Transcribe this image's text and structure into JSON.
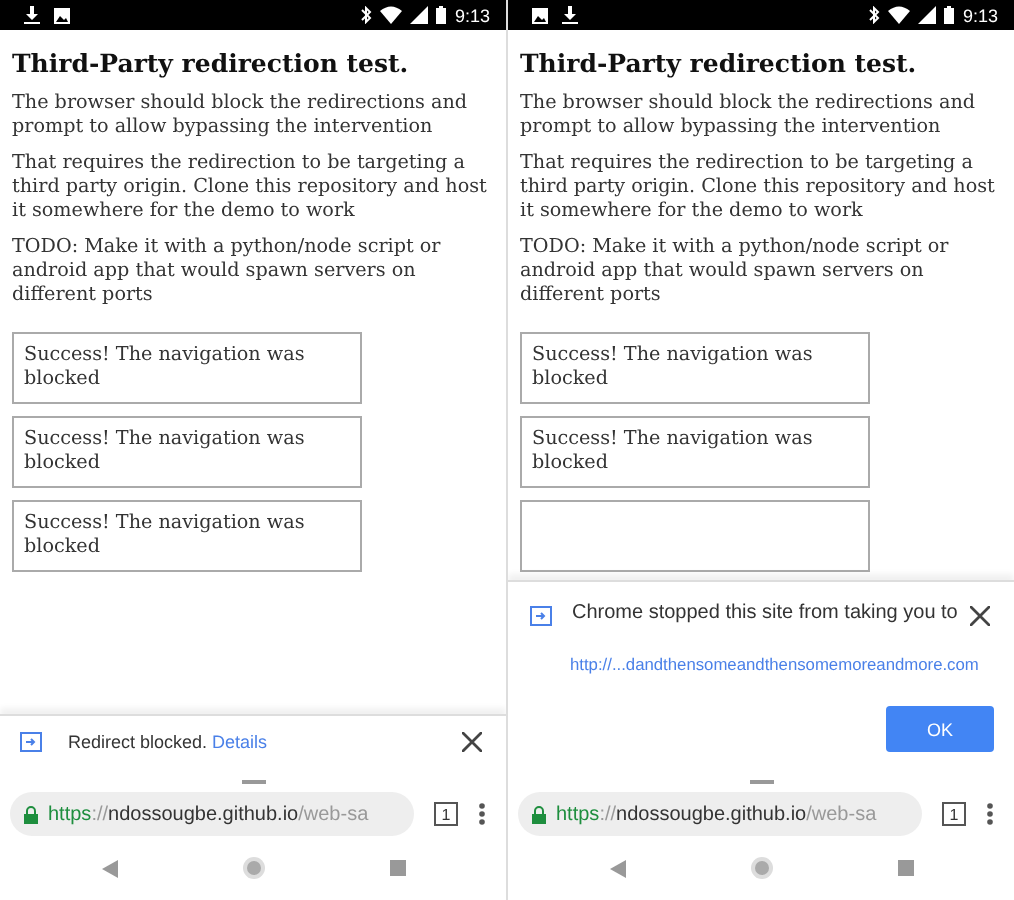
{
  "screens": [
    {
      "status": {
        "time": "9:13"
      },
      "page": {
        "title": "Third-Party redirection test.",
        "paragraphs": [
          "The browser should block the redirections and prompt to allow bypassing the intervention",
          "That requires the redirection to be targeting a third party origin. Clone this repository and host it somewhere for the demo to work",
          "TODO: Make it with a python/node script or android app that would spawn servers on different ports"
        ],
        "results": [
          "Success! The navigation was blocked",
          "Success! The navigation was blocked",
          "Success! The navigation was blocked"
        ]
      },
      "notice": {
        "kind": "infobar",
        "message": "Redirect blocked.",
        "link": "Details"
      },
      "omnibox": {
        "scheme": "https",
        "separator": "://",
        "host": "ndossougbe.github.io",
        "path": "/web-sa",
        "tab_count": "1"
      }
    },
    {
      "status": {
        "time": "9:13"
      },
      "page": {
        "title": "Third-Party redirection test.",
        "paragraphs": [
          "The browser should block the redirections and prompt to allow bypassing the intervention",
          "That requires the redirection to be targeting a third party origin. Clone this repository and host it somewhere for the demo to work",
          "TODO: Make it with a python/node script or android app that would spawn servers on different ports"
        ],
        "results": [
          "Success! The navigation was blocked",
          "Success! The navigation was blocked"
        ]
      },
      "notice": {
        "kind": "dialog",
        "message": "Chrome stopped this site from taking you to",
        "url": "http://...dandthensomeandthensomemoreandmore.com",
        "button": "OK"
      },
      "omnibox": {
        "scheme": "https",
        "separator": "://",
        "host": "ndossougbe.github.io",
        "path": "/web-sa",
        "tab_count": "1"
      }
    }
  ]
}
